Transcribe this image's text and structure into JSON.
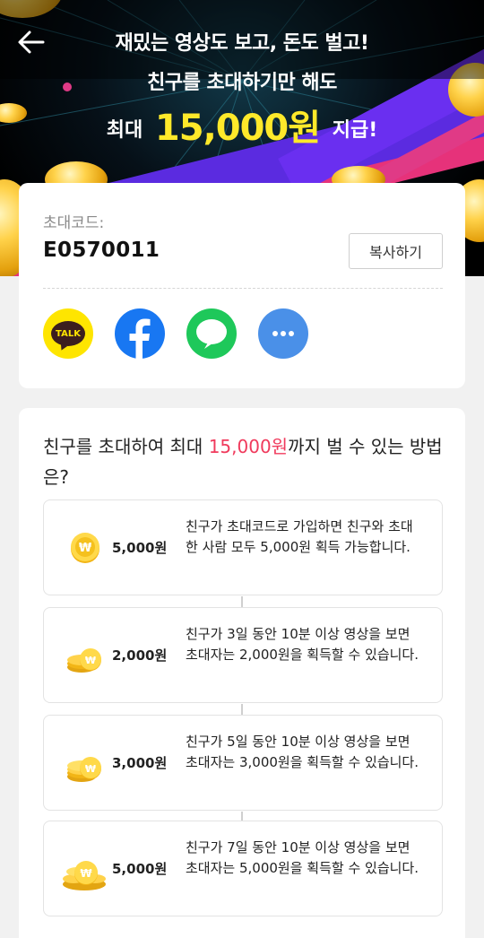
{
  "banner": {
    "line1": "재밌는 영상도 보고, 돈도 벌고!",
    "line2": "친구를 초대하기만 해도",
    "line3_prefix": "최대",
    "line3_amount": "15,000원",
    "line3_suffix": "지급!"
  },
  "invite": {
    "label": "초대코드:",
    "code": "E0570011",
    "copy_label": "복사하기"
  },
  "share": {
    "kakao_text": "TALK",
    "icons": [
      "kakao-talk-icon",
      "facebook-icon",
      "line-icon",
      "more-icon"
    ]
  },
  "how": {
    "title_prefix": "친구를 초대하여 최대 ",
    "title_amount": "15,000원",
    "title_suffix": "까지 벌 수 있는 방법은?",
    "steps": [
      {
        "amount": "5,000원",
        "desc": "친구가 초대코드로 가입하면 친구와 초대한 사람 모두 5,000원 획득 가능합니다."
      },
      {
        "amount": "2,000원",
        "desc": "친구가 3일 동안 10분 이상 영상을 보면 초대자는 2,000원을 획득할 수 있습니다."
      },
      {
        "amount": "3,000원",
        "desc": "친구가 5일 동안 10분 이상 영상을 보면 초대자는 3,000원을 획득할 수 있습니다."
      },
      {
        "amount": "5,000원",
        "desc": "친구가 7일 동안 10분 이상 영상을 보면 초대자는 5,000원을 획득할 수 있습니다."
      }
    ]
  },
  "colors": {
    "accent": "#f03a5c",
    "highlight": "#ffe92a",
    "kakao": "#fee500",
    "facebook": "#1877f2",
    "line": "#1ec85a",
    "more": "#4a90e8"
  }
}
